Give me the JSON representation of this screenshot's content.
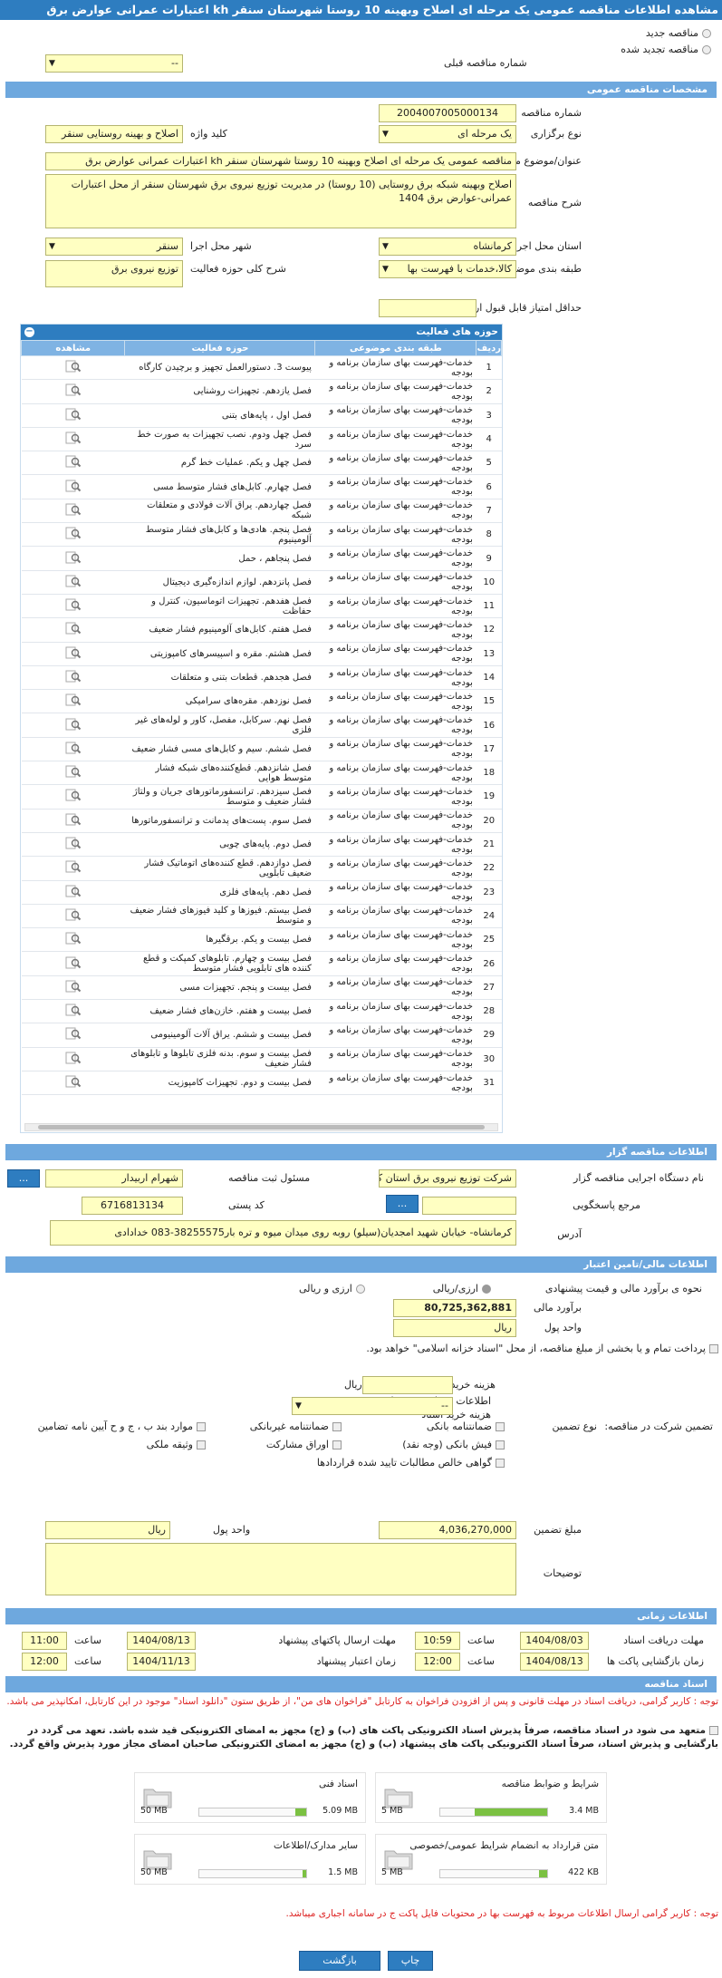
{
  "page_title": "مشاهده اطلاعات مناقصه عمومی یک مرحله ای اصلاح وبهینه 10 روستا شهرستان سنقر kh اعتبارات عمرانی عوارض برق",
  "top": {
    "radio_new": "مناقصه جدید",
    "radio_renew": "مناقصه تجدید شده",
    "prev_number_label": "شماره مناقصه قبلی",
    "prev_number_value": "--"
  },
  "general": {
    "section_title": "مشخصات مناقصه عمومی",
    "number_label": "شماره مناقصه",
    "number_value": "2004007005000134",
    "type_label": "نوع برگزاری",
    "type_value": "یک مرحله ای",
    "keyword_label": "کلید واژه",
    "keyword_value": "اصلاح و بهینه روستایی سنقر",
    "subject_label": "عنوان/موضوع مناقصه",
    "subject_value": "مناقصه عمومی یک مرحله ای اصلاح وبهینه 10 روستا شهرستان سنقر kh اعتبارات عمرانی عوارض برق",
    "desc_label": "شرح مناقصه",
    "desc_value": "اصلاح وبهینه شبکه برق روستایی (10 روستا) در  مدیریت توزیع نیروی برق شهرستان سنقر  از محل اعتبارات عمرانی-عوارض برق 1404",
    "province_label": "استان محل اجرا",
    "province_value": "کرمانشاه",
    "city_label": "شهر محل اجرا",
    "city_value": "سنقر",
    "category_label": "طبقه بندی موضوعی",
    "category_value": "کالا،خدمات با فهرست بها",
    "scope_label": "شرح کلی حوزه فعالیت",
    "scope_value": "توزیع نیروی برق",
    "min_score_label": "حداقل امتیاز قابل قبول ارزیابی فنی/بازرگانی",
    "min_score_value": ""
  },
  "activities": {
    "title": "حوزه های فعالیت",
    "headers": [
      "ردیف",
      "طبقه بندی موضوعی",
      "حوزه فعالیت",
      "مشاهده"
    ],
    "category_text": "خدمات-فهرست بهای سازمان برنامه و بودجه",
    "rows": [
      "پیوست 3. دستورالعمل تجهیز و برچیدن کارگاه",
      "فصل یازدهم. تجهیزات روشنایی",
      "فصل اول ، پایه‌های بتنی",
      "فصل چهل ودوم. نصب تجهیزات به صورت خط سرد",
      "فصل چهل و یکم. عملیات خط گرم",
      "فصل چهارم. کابل‌های فشار متوسط مسی",
      "فصل چهاردهم. یراق آلات فولادی و متعلقات شبکه",
      "فصل پنجم. هادی‌ها و کابل‌های فشار متوسط آلومینیوم",
      "فصل پنجاهم ، حمل",
      "فصل پانزدهم. لوازم اندازه‌گیری دیجیتال",
      "فصل هفدهم. تجهیزات اتوماسیون، کنترل و حفاظت",
      "فصل هفتم. کابل‌های آلومینیوم فشار ضعیف",
      "فصل هشتم. مقره و اسپیسرهای کامپوزیتی",
      "فصل هجدهم. قطعات بتنی و متعلقات",
      "فصل نوزدهم. مقره‌های سرامیکی",
      "فصل نهم. سرکابل، مفصل، کاور و لوله‌های غیر فلزی",
      "فصل ششم. سیم و کابل‌های مسی فشار ضعیف",
      "فصل شانزدهم. قطع‌کننده‌های شبکه فشار متوسط هوایی",
      "فصل سیزدهم. ترانسفورماتورهای جریان و ولتاژ فشار ضعیف و متوسط",
      "فصل سوم. پست‌های پدمانت و ترانسفورماتورها",
      "فصل دوم. پایه‌های چوبی",
      "فصل دوازدهم. قطع کننده‌های اتوماتیک فشار ضعیف تابلویی",
      "فصل دهم. پایه‌های فلزی",
      "فصل بیستم. فیوزها و کلید فیوزهای فشار ضعیف و متوسط",
      "فصل بیست و یکم. برقگیرها",
      "فصل بیست و چهارم. تابلوهای کمپکت و قطع کننده های تابلویی فشار متوسط",
      "فصل بیست و پنجم. تجهیزات مسی",
      "فصل بیست و هفتم. خازن‌های فشار ضعیف",
      "فصل بیست و ششم. یراق آلات آلومینیومی",
      "فصل بیست و سوم. بدنه فلزی تابلوها و تابلوهای فشار ضعیف",
      "فصل بیست و دوم. تجهیزات کامپوزیت"
    ]
  },
  "organizer": {
    "section_title": "اطلاعات مناقصه گزار",
    "org_label": "نام دستگاه اجرایی مناقصه گزار",
    "org_value": "شرکت توزیع نیروی برق استان کرمانشاه",
    "responsible_label": "مسئول ثبت مناقصه",
    "responsible_value": "شهرام اربیدار",
    "ref_label": "مرجع پاسخگویی",
    "ref_value": "",
    "postal_label": "کد پستی",
    "postal_value": "6716813134",
    "address_label": "آدرس",
    "address_value": "کرمانشاه- خیابان شهید امجدیان(سیلو) روبه روی میدان میوه و تره بار38255575-083 خدادادی",
    "more_button": "..."
  },
  "financial": {
    "section_title": "اطلاعات مالی/تامین اعتبار",
    "estimate_label": "نحوه ی برآورد مالی و قیمت پیشنهادی",
    "opt_rial": "ارزی/ریالی",
    "opt_currency_rial": "ارزی و ریالی",
    "amount_label": "برآورد مالی",
    "amount_value": "80,725,362,881",
    "unit_label": "واحد پول",
    "unit_value": "ریال",
    "payment_note": "پرداخت تمام و یا بخشی از مبلغ مناقصه، از محل \"اسناد خزانه اسلامی\" خواهد بود.",
    "doc_cost_label": "هزینه خرید اسناد",
    "doc_cost_value": "",
    "doc_cost_unit": "ریال",
    "account_label": "اطلاعات حساب جهت واریز هزینه خرید اسناد",
    "account_value": "--"
  },
  "guarantee": {
    "type_label": "تضمین شرکت در مناقصه:",
    "kind_label": "نوع تضمین",
    "options": [
      "ضمانتنامه بانکی",
      "ضمانتنامه غیربانکی",
      "موارد بند ب ، ج و ح آیین نامه تضامین",
      "فیش بانکی (وجه نقد)",
      "اوراق مشارکت",
      "وثیقه ملکی",
      "گواهی خالص مطالبات تایید شده قراردادها"
    ],
    "amount_label": "مبلغ تضمین",
    "amount_value": "4,036,270,000",
    "unit_label": "واحد پول",
    "unit_value": "ریال",
    "notes_label": "توضیحات",
    "notes_value": ""
  },
  "timing": {
    "section_title": "اطلاعات زمانی",
    "receive_deadline_label": "مهلت دریافت اسناد",
    "receive_deadline_date": "1404/08/03",
    "receive_deadline_time": "10:59",
    "send_deadline_label": "مهلت ارسال پاکتهای پیشنهاد",
    "send_deadline_date": "1404/08/13",
    "send_deadline_time": "11:00",
    "open_label": "زمان بازگشایی پاکت ها",
    "open_date": "1404/08/13",
    "open_time": "12:00",
    "validity_label": "زمان اعتبار پیشنهاد",
    "validity_date": "1404/11/13",
    "validity_time": "12:00",
    "time_label": "ساعت"
  },
  "documents": {
    "section_title": "اسناد مناقصه",
    "note1": "توجه : کاربر گرامی، دریافت اسناد در مهلت قانونی و پس از افزودن فراخوان به کارتابل \"فراخوان های من\"، از طریق ستون \"دانلود اسناد\" موجود در این کارتابل، امکانپذیر می باشد.",
    "note2": "متعهد می شود در اسناد مناقصه، صرفاً پذیرش اسناد الکترونیکی پاکت های (ب) و (ج) مجهز به امضای الکترونیکی قید شده باشد. تعهد می گردد در بارگشایی و پذیرش اسناد، صرفاً اسناد الکترونیکی پاکت های پیشنهاد (ب) و (ج) مجهز به امضای الکترونیکی صاحبان امضای مجاز مورد پذیرش واقع گردد.",
    "items": [
      {
        "name": "شرایط و ضوابط مناقصه",
        "size": "3.4 MB",
        "max": "5 MB",
        "fill": 0.68
      },
      {
        "name": "اسناد فنی",
        "size": "5.09 MB",
        "max": "50 MB",
        "fill": 0.1
      },
      {
        "name": "متن قرارداد به انضمام شرایط عمومی/خصوصی",
        "size": "422 KB",
        "max": "5 MB",
        "fill": 0.08
      },
      {
        "name": "سایر مدارک/اطلاعات",
        "size": "1.5 MB",
        "max": "50 MB",
        "fill": 0.03
      }
    ],
    "note3": "توجه : کاربر گرامی ارسال اطلاعات مربوط به فهرست بها در محتویات فایل پاکت ج در سامانه اجباری میباشد."
  },
  "buttons": {
    "back": "بازگشت",
    "print": "چاپ"
  },
  "colors": {
    "header": "#2e7dc0",
    "section": "#6ea8de",
    "input": "#ffffc2",
    "progress": "#7bc142"
  }
}
